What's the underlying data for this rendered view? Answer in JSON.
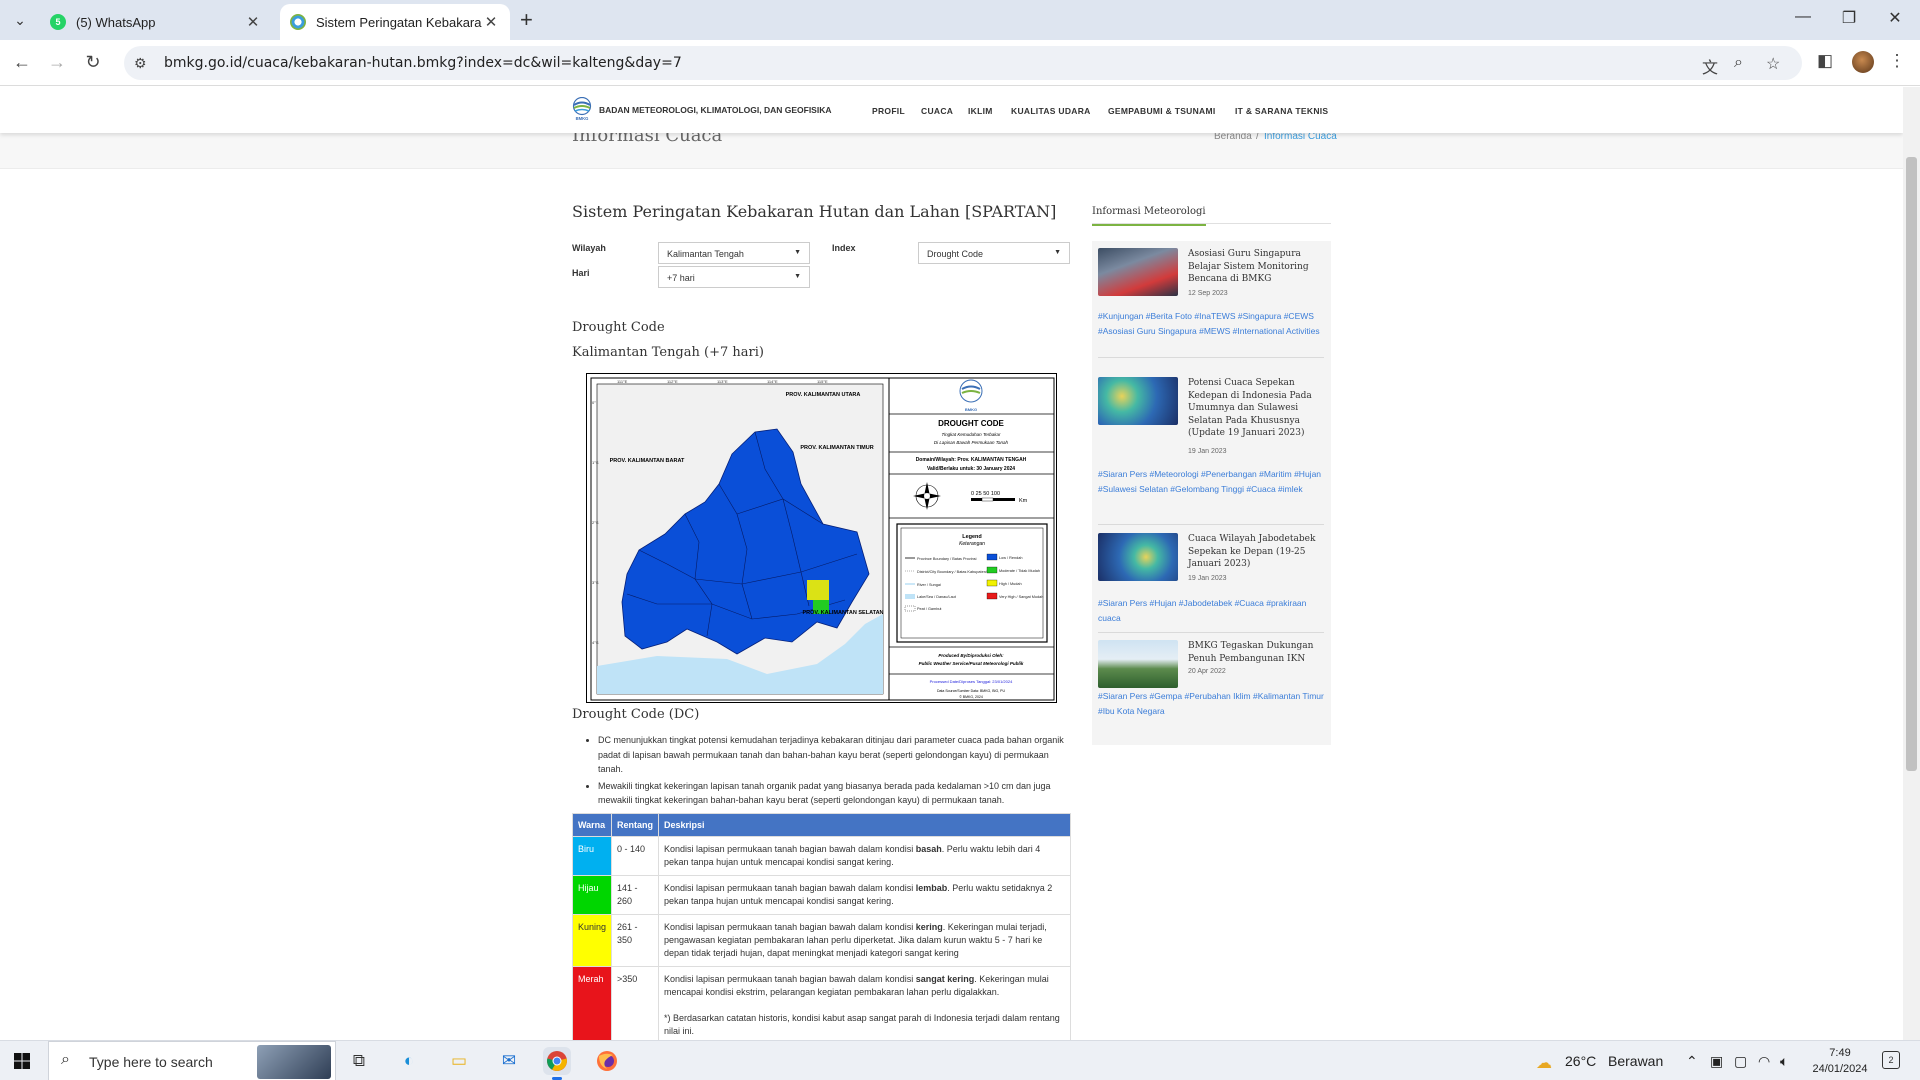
{
  "browser": {
    "tabs": [
      {
        "title": "(5) WhatsApp",
        "favicon_color": "#25d366",
        "favicon_text": "5",
        "active": false
      },
      {
        "title": "Sistem Peringatan Kebakaran H",
        "favicon_color": "#3b9ddd",
        "favicon_text": "",
        "active": true
      }
    ],
    "url": "bmkg.go.id/cuaca/kebakaran-hutan.bmkg?index=dc&wil=kalteng&day=7"
  },
  "site": {
    "brand": "BADAN METEOROLOGI, KLIMATOLOGI, DAN GEOFISIKA",
    "logo_text": "BMKG",
    "nav": [
      "PROFIL",
      "CUACA",
      "IKLIM",
      "KUALITAS UDARA",
      "GEMPABUMI & TSUNAMI",
      "IT & SARANA TEKNIS"
    ],
    "page_title": "Informasi Cuaca",
    "breadcrumb": [
      "Beranda",
      "/",
      "Informasi Cuaca"
    ]
  },
  "main": {
    "heading": "Sistem Peringatan Kebakaran Hutan dan Lahan [SPARTAN]",
    "form": {
      "wilayah_label": "Wilayah",
      "wilayah_value": "Kalimantan Tengah",
      "hari_label": "Hari",
      "hari_value": "+7 hari",
      "index_label": "Index",
      "index_value": "Drought Code"
    },
    "subtitle1": "Drought Code",
    "subtitle2": "Kalimantan Tengah (+7 hari)",
    "map": {
      "logo_text": "BMKG",
      "title": "DROUGHT CODE",
      "subtitle_a": "Tingkat Kemudahan Terbakar",
      "subtitle_b": "Di Lapisan Bawah Permukaan Tanah",
      "domain": "Domain/Wilayah: Prov. KALIMANTAN TENGAH",
      "valid": "Valid/Berlaku untuk: 30 January 2024",
      "scale": "0  25 50      100",
      "scale_unit": "Km",
      "legend_title": "Legend",
      "legend_subtitle": "Keterangan",
      "legend_left": [
        "Province Boundary / Batas Provinsi",
        "District/City Boundary / Batas Kabupaten/Kota",
        "River / Sungai",
        "Lake/Sea / Danau/Laut",
        "Peat / Gambut"
      ],
      "legend_right": [
        {
          "label": "Low / Rendah",
          "color": "#0a4fd8"
        },
        {
          "label": "Moderate / Tidak Mudah",
          "color": "#22cc22"
        },
        {
          "label": "High / Mudah",
          "color": "#f2f200"
        },
        {
          "label": "Very High / Sangat Mudah",
          "color": "#e81b1b"
        }
      ],
      "produced_a": "Produced By/Diproduksi Oleh:",
      "produced_b": "Public Weather Service/Pusat Meteorologi Publik",
      "processed": "Processed Date/Diproses Tanggal: 23/01/2024",
      "source": "Data Source/Sumber Data: BMKG, BIG, PU",
      "copyright": "© BMKG, 2024",
      "prov_labels": [
        "PROV. KALIMANTAN BARAT",
        "PROV. KALIMANTAN TIMUR",
        "PROV. KALIMANTAN UTARA",
        "PROV. KALIMANTAN SELATAN"
      ],
      "grid_lon": [
        "111°E",
        "112°E",
        "113°E",
        "114°E",
        "115°E"
      ],
      "grid_lat": [
        "0°",
        "1°S",
        "2°S",
        "3°S",
        "4°S"
      ],
      "level_low_color": "#0a4fd8"
    },
    "dc_heading": "Drought Code (DC)",
    "notes": [
      "DC menunjukkan tingkat potensi kemudahan terjadinya kebakaran ditinjau dari parameter cuaca pada bahan organik padat di lapisan bawah permukaan tanah dan bahan-bahan kayu berat (seperti gelondongan kayu) di permukaan tanah.",
      "Mewakili tingkat kekeringan lapisan tanah organik padat yang biasanya berada pada kedalaman >10 cm dan juga mewakili tingkat kekeringan bahan-bahan kayu berat (seperti gelondongan kayu) di permukaan tanah."
    ],
    "table": {
      "headers": [
        "Warna",
        "Rentang",
        "Deskripsi"
      ],
      "rows": [
        {
          "warna": "Biru",
          "color": "#00b0f0",
          "rentang": "0 - 140",
          "pre": "Kondisi lapisan permukaan tanah bagian bawah dalam kondisi ",
          "bold": "basah",
          "post": ". Perlu waktu lebih dari 4 pekan tanpa hujan untuk mencapai kondisi sangat kering.",
          "note": ""
        },
        {
          "warna": "Hijau",
          "color": "#00d600",
          "rentang": "141 - 260",
          "pre": "Kondisi lapisan permukaan tanah bagian bawah dalam kondisi ",
          "bold": "lembab",
          "post": ". Perlu waktu setidaknya 2 pekan tanpa hujan untuk mencapai kondisi sangat kering.",
          "note": ""
        },
        {
          "warna": "Kuning",
          "color": "#ffff00",
          "rentang": "261 - 350",
          "pre": "Kondisi lapisan permukaan tanah bagian bawah dalam kondisi ",
          "bold": "kering",
          "post": ". Kekeringan mulai terjadi, pengawasan kegiatan pembakaran lahan perlu diperketat. Jika dalam kurun waktu 5 - 7 hari ke depan tidak terjadi hujan, dapat meningkat menjadi kategori sangat kering",
          "note": ""
        },
        {
          "warna": "Merah",
          "color": "#e8141b",
          "rentang": ">350",
          "pre": "Kondisi lapisan permukaan tanah bagian bawah dalam kondisi ",
          "bold": "sangat kering",
          "post": ". Kekeringan mulai mencapai kondisi ekstrim, pelarangan kegiatan pembakaran lahan perlu digalakkan.",
          "note": "*) Berdasarkan catatan historis, kondisi kabut asap sangat parah di Indonesia terjadi dalam rentang nilai ini."
        }
      ]
    }
  },
  "sidebar": {
    "title": "Informasi Meteorologi",
    "news": [
      {
        "title": "Asosiasi Guru Singapura Belajar Sistem Monitoring Bencana di BMKG",
        "date": "12 Sep 2023",
        "tags": "#Kunjungan #Berita Foto #InaTEWS #Singapura #CEWS #Asosiasi Guru Singapura #MEWS #International Activities"
      },
      {
        "title": "Potensi Cuaca Sepekan Kedepan di Indonesia Pada Umumnya dan Sulawesi Selatan Pada Khususnya (Update 19 Januari 2023)",
        "date": "19 Jan 2023",
        "tags": "#Siaran Pers #Meteorologi #Penerbangan #Maritim #Hujan #Sulawesi Selatan #Gelombang Tinggi #Cuaca #imlek"
      },
      {
        "title": "Cuaca Wilayah Jabodetabek Sepekan ke Depan (19-25 Januari 2023)",
        "date": "19 Jan 2023",
        "tags": "#Siaran Pers #Hujan #Jabodetabek #Cuaca #prakiraan cuaca"
      },
      {
        "title": "BMKG Tegaskan Dukungan Penuh Pembangunan IKN",
        "date": "20 Apr 2022",
        "tags": "#Siaran Pers #Gempa #Perubahan Iklim #Kalimantan Timur #Ibu Kota Negara"
      }
    ]
  },
  "taskbar": {
    "search_placeholder": "Type here to search",
    "weather_temp": "26°C",
    "weather_text": "Berawan",
    "time": "7:49",
    "date": "24/01/2024",
    "notifications": "2"
  }
}
